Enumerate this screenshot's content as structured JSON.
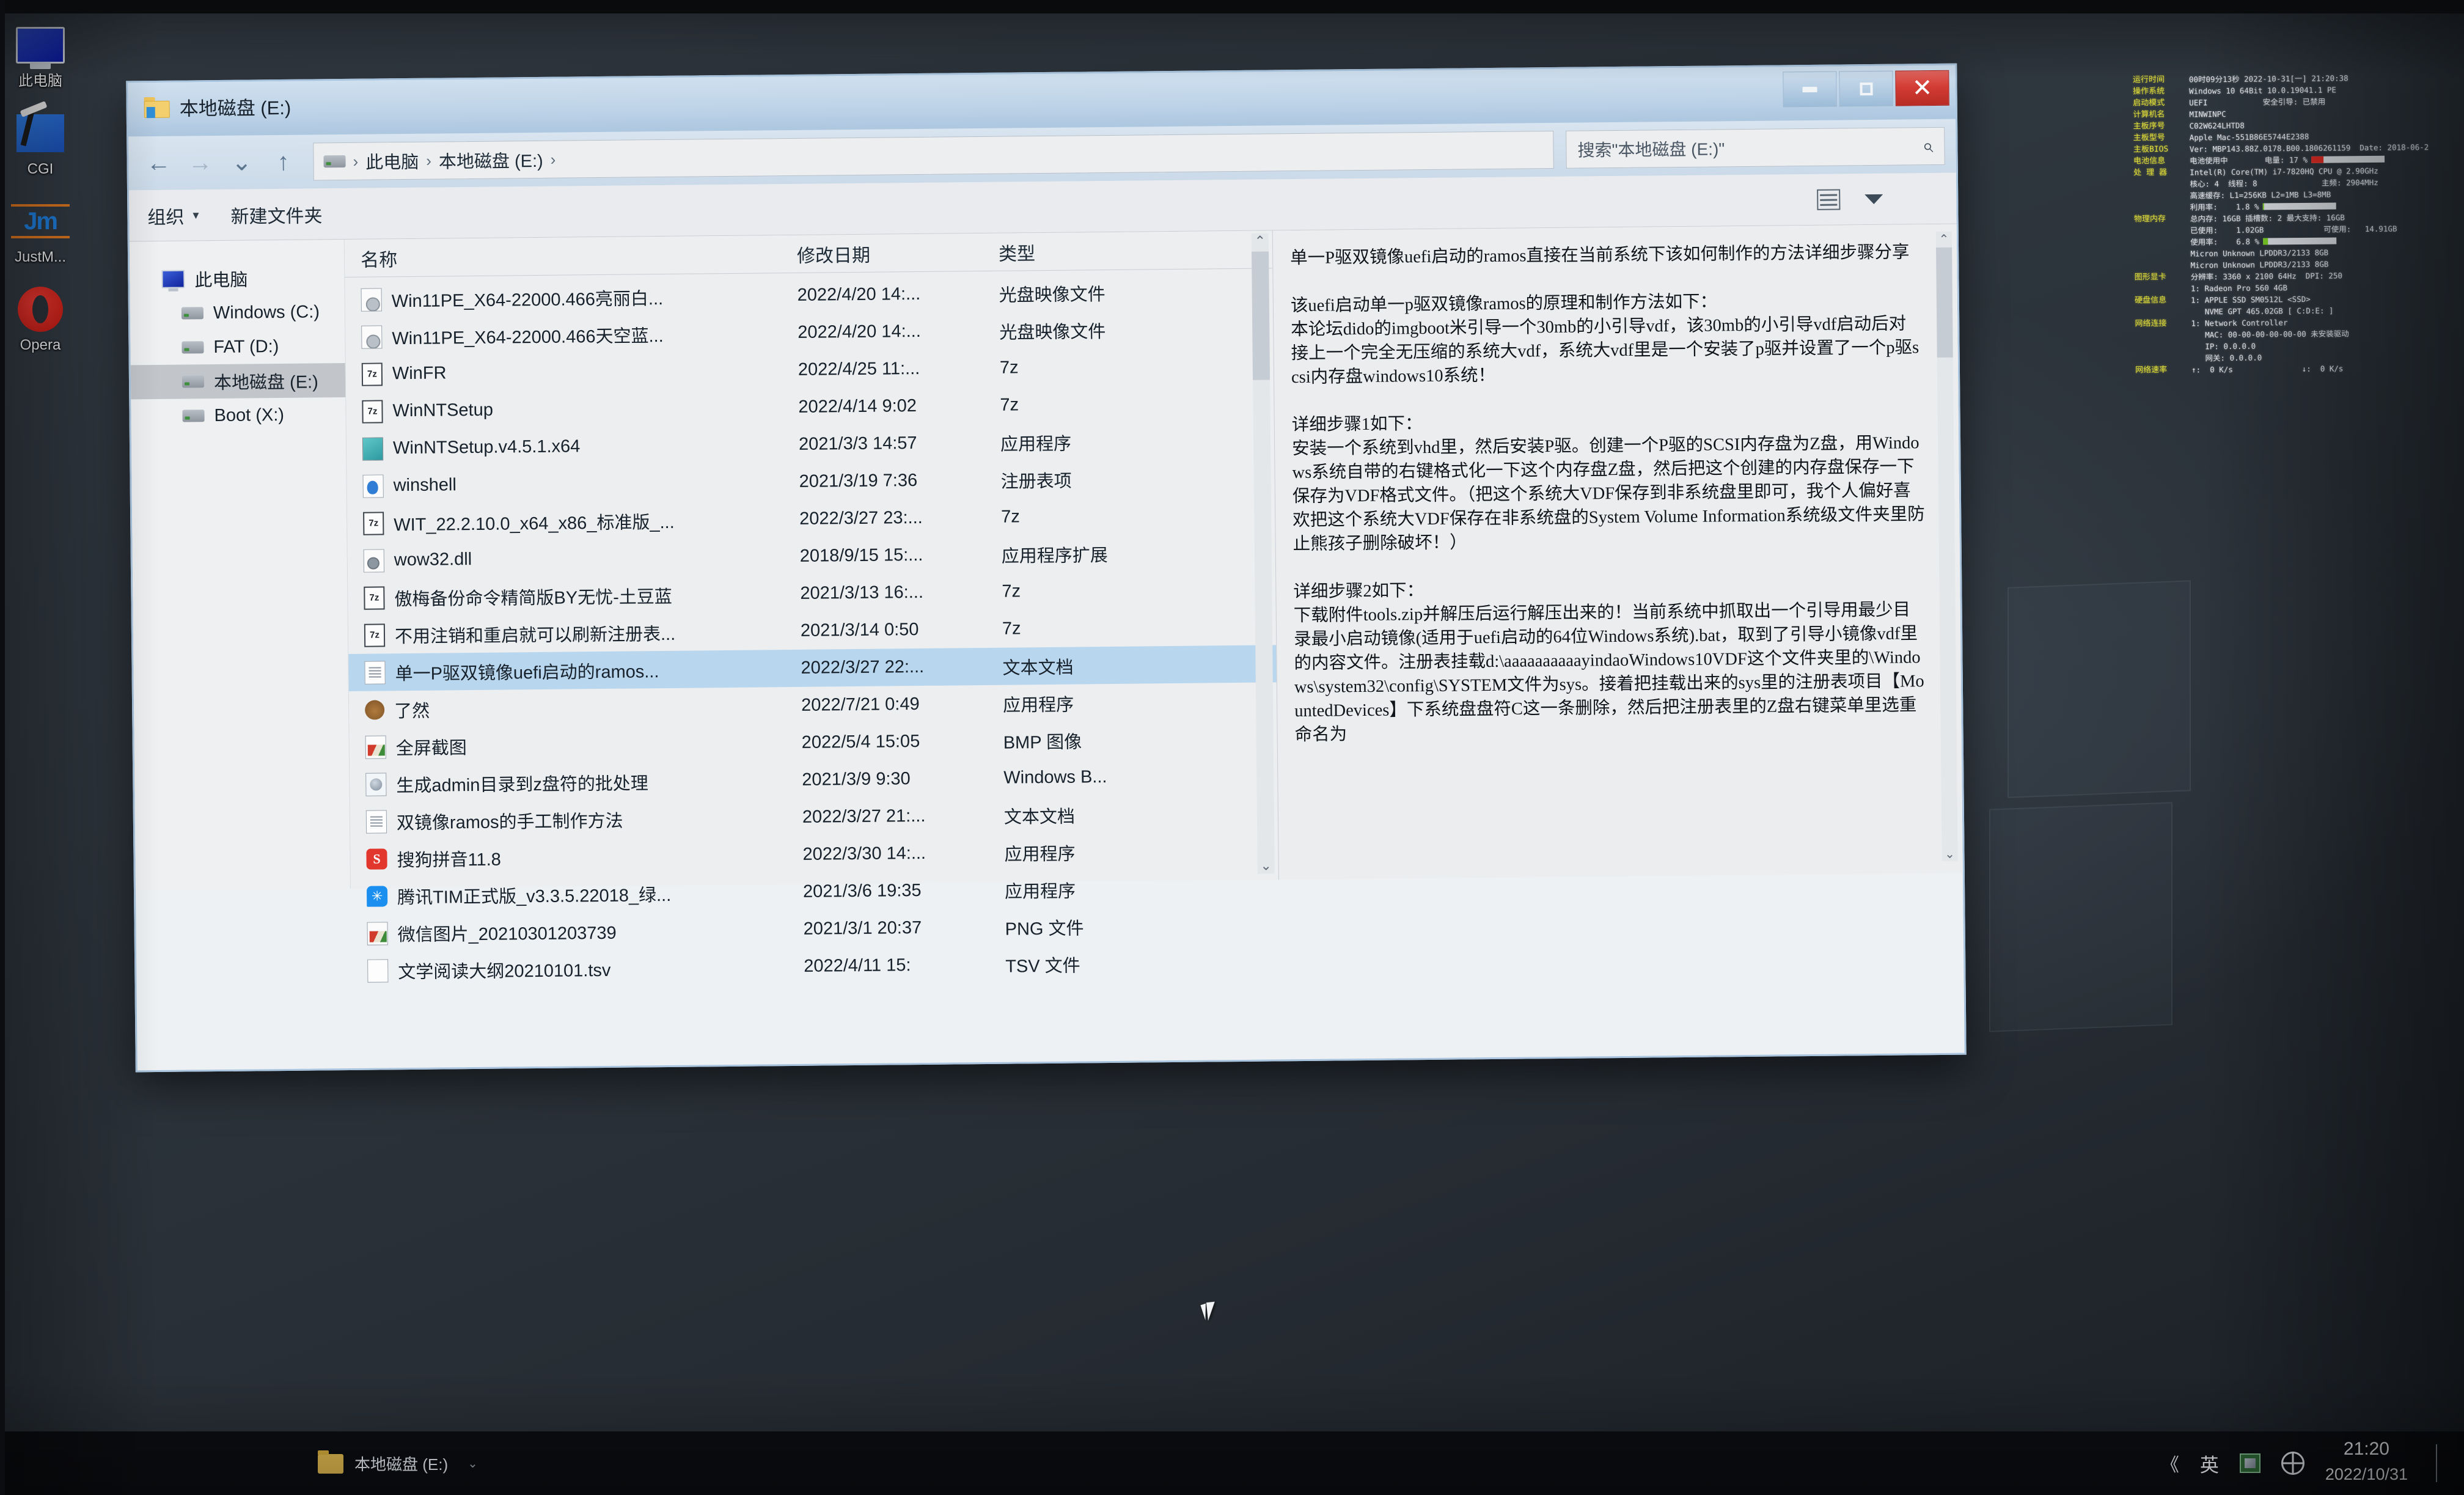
{
  "window": {
    "title": "本地磁盘 (E:)",
    "controls": {
      "minimize": "–",
      "maximize": "□",
      "close": "✕"
    }
  },
  "nav": {
    "back": "←",
    "forward": "→",
    "recent": "⌄",
    "up": "↑",
    "breadcrumb": [
      "此电脑",
      "本地磁盘 (E:)"
    ],
    "sep": "›",
    "search_placeholder": "搜索\"本地磁盘 (E:)\"",
    "search_value": "",
    "search_icon": "⌕"
  },
  "toolbar": {
    "organize": "组织",
    "organize_caret": "▾",
    "new_folder": "新建文件夹"
  },
  "navpane": {
    "root": "此电脑",
    "items": [
      {
        "label": "Windows (C:)",
        "selected": false
      },
      {
        "label": "FAT (D:)",
        "selected": false
      },
      {
        "label": "本地磁盘 (E:)",
        "selected": true
      },
      {
        "label": "Boot (X:)",
        "selected": false
      }
    ]
  },
  "columns": {
    "name": "名称",
    "date": "修改日期",
    "type": "类型"
  },
  "files": [
    {
      "name": "Win11PE_X64-22000.466亮丽白...",
      "date": "2022/4/20 14:...",
      "type": "光盘映像文件",
      "icon": "iso-icon",
      "selected": false
    },
    {
      "name": "Win11PE_X64-22000.466天空蓝...",
      "date": "2022/4/20 14:...",
      "type": "光盘映像文件",
      "icon": "iso-icon",
      "selected": false
    },
    {
      "name": "WinFR",
      "date": "2022/4/25 11:...",
      "type": "7z",
      "icon": "archive-7z-icon",
      "selected": false
    },
    {
      "name": "WinNTSetup",
      "date": "2022/4/14 9:02",
      "type": "7z",
      "icon": "archive-7z-icon",
      "selected": false
    },
    {
      "name": "WinNTSetup.v4.5.1.x64",
      "date": "2021/3/3 14:57",
      "type": "应用程序",
      "icon": "application-icon",
      "selected": false
    },
    {
      "name": "winshell",
      "date": "2021/3/19 7:36",
      "type": "注册表项",
      "icon": "registry-icon",
      "selected": false
    },
    {
      "name": "WIT_22.2.10.0_x64_x86_标准版_...",
      "date": "2022/3/27 23:...",
      "type": "7z",
      "icon": "archive-7z-icon",
      "selected": false
    },
    {
      "name": "wow32.dll",
      "date": "2018/9/15 15:...",
      "type": "应用程序扩展",
      "icon": "dll-icon",
      "selected": false
    },
    {
      "name": "傲梅备份命令精简版BY无忧-土豆蓝",
      "date": "2021/3/13 16:...",
      "type": "7z",
      "icon": "archive-7z-icon",
      "selected": false
    },
    {
      "name": "不用注销和重启就可以刷新注册表...",
      "date": "2021/3/14 0:50",
      "type": "7z",
      "icon": "archive-7z-icon",
      "selected": false
    },
    {
      "name": "单一P驱双镜像uefi启动的ramos...",
      "date": "2022/3/27 22:...",
      "type": "文本文档",
      "icon": "text-document-icon",
      "selected": true
    },
    {
      "name": "了然",
      "date": "2022/7/21 0:49",
      "type": "应用程序",
      "icon": "bear-app-icon",
      "selected": false
    },
    {
      "name": "全屏截图",
      "date": "2022/5/4 15:05",
      "type": "BMP 图像",
      "icon": "image-icon",
      "selected": false
    },
    {
      "name": "生成admin目录到z盘符的批处理",
      "date": "2021/3/9 9:30",
      "type": "Windows B...",
      "icon": "batch-file-icon",
      "selected": false
    },
    {
      "name": "双镜像ramos的手工制作方法",
      "date": "2022/3/27 21:...",
      "type": "文本文档",
      "icon": "text-document-icon",
      "selected": false
    },
    {
      "name": "搜狗拼音11.8",
      "date": "2022/3/30 14:...",
      "type": "应用程序",
      "icon": "sogou-icon",
      "selected": false
    },
    {
      "name": "腾讯TIM正式版_v3.3.5.22018_绿...",
      "date": "2021/3/6 19:35",
      "type": "应用程序",
      "icon": "tim-icon",
      "selected": false
    },
    {
      "name": "微信图片_20210301203739",
      "date": "2021/3/1 20:37",
      "type": "PNG 文件",
      "icon": "image-icon",
      "selected": false
    },
    {
      "name": "文学阅读大纲20210101.tsv",
      "date": "2022/4/11 15:",
      "type": "TSV 文件",
      "icon": "tsv-icon",
      "selected": false
    }
  ],
  "preview": {
    "paragraphs": [
      "单一P驱双镜像uefi启动的ramos直接在当前系统下该如何制作的方法详细步骤分享",
      "",
      "该uefi启动单一p驱双镜像ramos的原理和制作方法如下：",
      "本论坛dido的imgboot米引导一个30mb的小引导vdf，该30mb的小引导vdf启动后对接上一个完全无压缩的系统大vdf，系统大vdf里是一个安装了p驱并设置了一个p驱scsi内存盘windows10系统！",
      "",
      "详细步骤1如下：",
      "安装一个系统到vhd里，然后安装P驱。创建一个P驱的SCSI内存盘为Z盘，用Windows系统自带的右键格式化一下这个内存盘Z盘，然后把这个创建的内存盘保存一下保存为VDF格式文件。（把这个系统大VDF保存到非系统盘里即可，我个人偏好喜欢把这个系统大VDF保存在非系统盘的System Volume Information系统级文件夹里防止熊孩子删除破坏！）",
      "",
      "详细步骤2如下：",
      "下载附件tools.zip并解压后运行解压出来的！当前系统中抓取出一个引导用最少目录最小启动镜像(适用于uefi启动的64位Windows系统).bat，取到了引导小镜像vdf里的内容文件。注册表挂载d:\\aaaaaaaaaayindaoWindows10VDF这个文件夹里的\\Windows\\system32\\config\\SYSTEM文件为sys。接着把挂载出来的sys里的注册表项目【MountedDevices】下系统盘盘符C这一条删除，然后把注册表里的Z盘右键菜单里选重命名为"
    ],
    "scroll_up": "⌃",
    "scroll_down": "⌄"
  },
  "desktop_icons": [
    {
      "label": "此电脑",
      "icon": "this-pc-icon"
    },
    {
      "label": "CGI",
      "icon": "cgi-icon"
    },
    {
      "label": "JustM...",
      "icon": "justmanager-icon"
    },
    {
      "label": "Opera",
      "icon": "opera-icon"
    }
  ],
  "sysinfo": {
    "rows": [
      {
        "label": "运行时间",
        "value": "00时09分13秒 2022-10-31[一] 21:20:38"
      },
      {
        "label": "操作系统",
        "value": "Windows 10 64Bit 10.0.19041.1 PE"
      },
      {
        "label": "启动模式",
        "value": "UEFI            安全引导: 已禁用"
      },
      {
        "label": "计算机名",
        "value": "MINWINPC"
      },
      {
        "label": "主板序号",
        "value": "C02W624LHTD8"
      },
      {
        "label": "主板型号",
        "value": "Apple Mac-551B86E5744E2388"
      },
      {
        "label": "主板BIOS",
        "value": "Ver: MBP143.88Z.0178.B00.1806261159  Date: 2018-06-2"
      },
      {
        "label": "电池信息",
        "value": "电池使用中        电量: 17 %",
        "bar": {
          "percent": 17,
          "color": "red"
        }
      },
      {
        "label": "处 理 器",
        "value": "Intel(R) Core(TM) i7-7820HQ CPU @ 2.90GHz"
      },
      {
        "label": "",
        "value": "核心: 4  线程: 8              主频: 2904MHz"
      },
      {
        "label": "",
        "value": "高速缓存: L1=256KB L2=1MB L3=8MB"
      },
      {
        "label": "",
        "value": "利用率:    1.8 %",
        "bar": {
          "percent": 2,
          "color": "green"
        }
      },
      {
        "label": "物理内存",
        "value": "总内存: 16GB 插槽数: 2 最大支持: 16GB"
      },
      {
        "label": "",
        "value": "已使用:    1.02GB             可使用:   14.91GB"
      },
      {
        "label": "",
        "value": "使用率:    6.8 %",
        "bar": {
          "percent": 7,
          "color": "green"
        }
      },
      {
        "label": "",
        "value": "Micron Unknown LPDDR3/2133 8GB"
      },
      {
        "label": "",
        "value": "Micron Unknown LPDDR3/2133 8GB"
      },
      {
        "label": "图形显卡",
        "value": "分辨率: 3360 x 2100 64Hz  DPI: 250"
      },
      {
        "label": "",
        "value": "1: Radeon Pro 560 4GB"
      },
      {
        "label": "硬盘信息",
        "value": "1: APPLE SSD SM0512L <SSD>"
      },
      {
        "label": "",
        "value": "   NVME GPT 465.02GB [ C:D:E: ]"
      },
      {
        "label": "网络连接",
        "value": "1: Network Controller"
      },
      {
        "label": "",
        "value": "   MAC: 00-00-00-00-00-00 未安装驱动"
      },
      {
        "label": "",
        "value": "   IP: 0.0.0.0"
      },
      {
        "label": "",
        "value": "   网关: 0.0.0.0"
      },
      {
        "label": "网络速率",
        "value": "↑:  0 K/s               ↓:  0 K/s"
      }
    ]
  },
  "taskbar": {
    "item_label": "本地磁盘 (E:)",
    "tray": {
      "expand": "《",
      "ime": "英",
      "network_icon": "globe-icon",
      "time": "21:20",
      "date": "2022/10/31"
    }
  }
}
